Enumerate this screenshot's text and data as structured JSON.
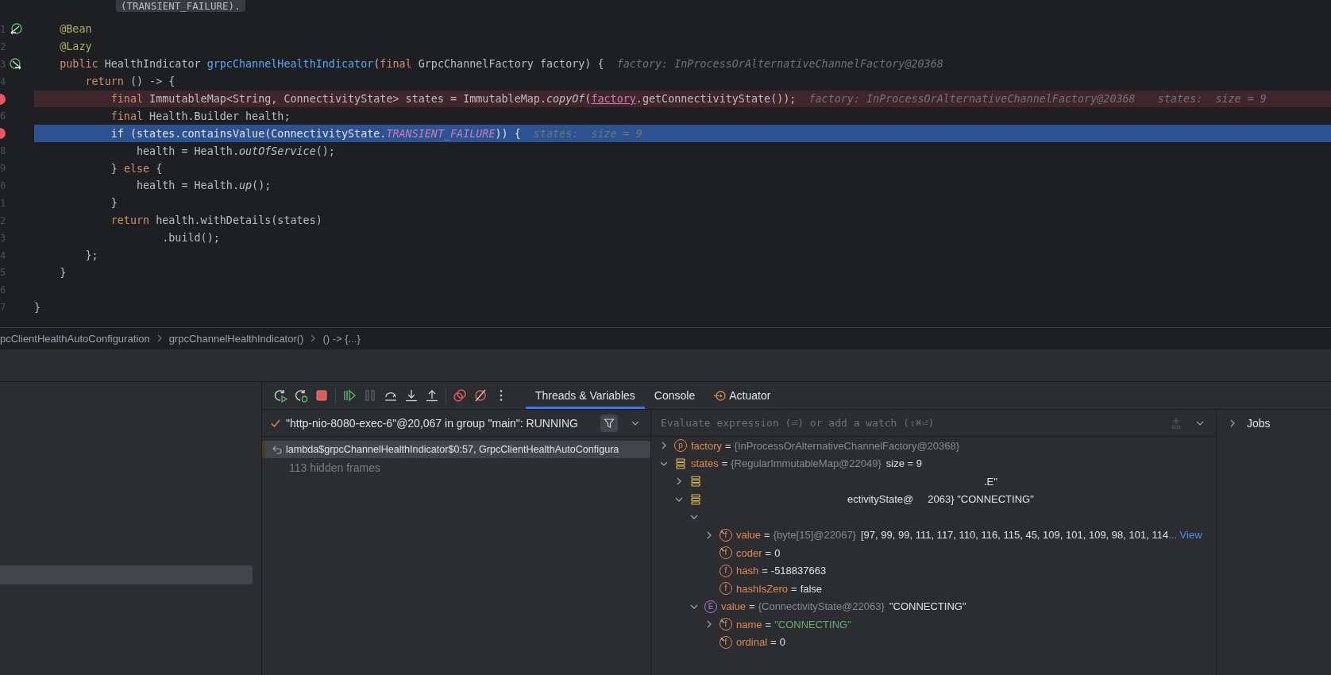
{
  "editor": {
    "tooltip_fragment": "(TRANSIENT_FAILURE).",
    "lines": [
      {
        "number": "1",
        "gutter": {
          "kind": "bean-out"
        },
        "code": [
          {
            "kind": "ann",
            "t": "    @Bean"
          }
        ]
      },
      {
        "number": "2",
        "code": [
          {
            "kind": "ann",
            "t": "    @Lazy"
          }
        ]
      },
      {
        "number": "3",
        "gutter": {
          "kind": "bean-in"
        },
        "code": [
          {
            "kind": "kw",
            "t": "    public"
          },
          {
            "kind": "p",
            "t": " HealthIndicator "
          },
          {
            "kind": "fn",
            "t": "grpcChannelHealthIndicator"
          },
          {
            "kind": "p",
            "t": "("
          },
          {
            "kind": "kw",
            "t": "final"
          },
          {
            "kind": "p",
            "t": " GrpcChannelFactory factory) {"
          }
        ],
        "hints": [
          "factory: InProcessOrAlternativeChannelFactory@20368"
        ]
      },
      {
        "number": "4",
        "code": [
          {
            "kind": "kw",
            "t": "        return"
          },
          {
            "kind": "p",
            "t": " () -> {"
          }
        ]
      },
      {
        "gutter": {
          "kind": "breakpoint"
        },
        "highlight": {
          "kind": "breakpoint"
        },
        "code": [
          {
            "kind": "kw",
            "t": "            final"
          },
          {
            "kind": "p",
            "t": " ImmutableMap<String, ConnectivityState> states = ImmutableMap."
          },
          {
            "kind": "it",
            "t": "copyOf"
          },
          {
            "kind": "p",
            "t": "("
          },
          {
            "kind": "link",
            "t": "factory"
          },
          {
            "kind": "p",
            "t": ".getConnectivityState());"
          }
        ],
        "hints": [
          "factory: InProcessOrAlternativeChannelFactory@20368",
          "states:  size = 9"
        ]
      },
      {
        "number": "6",
        "code": [
          {
            "kind": "kw",
            "t": "            final"
          },
          {
            "kind": "p",
            "t": " Health.Builder health;"
          }
        ]
      },
      {
        "gutter": {
          "kind": "breakpoint"
        },
        "highlight": {
          "kind": "current"
        },
        "code": [
          {
            "kind": "kw",
            "t": "            if"
          },
          {
            "kind": "p",
            "t": " (states.containsValue(ConnectivityState."
          },
          {
            "kind": "const",
            "t": "TRANSIENT_FAILURE"
          },
          {
            "kind": "p",
            "t": ")) {"
          }
        ],
        "hints": [
          "states:  size = 9"
        ]
      },
      {
        "number": "8",
        "code": [
          {
            "kind": "p",
            "t": "                health = Health."
          },
          {
            "kind": "it",
            "t": "outOfService"
          },
          {
            "kind": "p",
            "t": "();"
          }
        ]
      },
      {
        "number": "9",
        "code": [
          {
            "kind": "p",
            "t": "            } "
          },
          {
            "kind": "kw",
            "t": "else"
          },
          {
            "kind": "p",
            "t": " {"
          }
        ]
      },
      {
        "number": "0",
        "code": [
          {
            "kind": "p",
            "t": "                health = Health."
          },
          {
            "kind": "it",
            "t": "up"
          },
          {
            "kind": "p",
            "t": "();"
          }
        ]
      },
      {
        "number": "1",
        "code": [
          {
            "kind": "p",
            "t": "            }"
          }
        ]
      },
      {
        "number": "2",
        "code": [
          {
            "kind": "kw",
            "t": "            return"
          },
          {
            "kind": "p",
            "t": " health.withDetails(states)"
          }
        ]
      },
      {
        "number": "3",
        "code": [
          {
            "kind": "p",
            "t": "                    .build();"
          }
        ]
      },
      {
        "number": "4",
        "code": [
          {
            "kind": "p",
            "t": "        };"
          }
        ]
      },
      {
        "number": "5",
        "code": [
          {
            "kind": "p",
            "t": "    }"
          }
        ]
      },
      {
        "number": "6"
      },
      {
        "number": "7",
        "code": [
          {
            "kind": "p",
            "t": "}"
          }
        ]
      }
    ]
  },
  "breadcrumbs": [
    "pcClientHealthAutoConfiguration",
    "grpcChannelHealthIndicator()",
    "() -> {...}"
  ],
  "debugger": {
    "toolbar_groups": [
      [
        {
          "kind": "rerun",
          "disabled": false
        },
        {
          "kind": "rerun-debug",
          "disabled": false
        },
        {
          "kind": "stop",
          "disabled": false
        }
      ],
      [
        {
          "kind": "resume",
          "disabled": false
        },
        {
          "kind": "pause",
          "disabled": true
        },
        {
          "kind": "step-over",
          "disabled": false
        },
        {
          "kind": "step-into",
          "disabled": false
        },
        {
          "kind": "step-out",
          "disabled": false
        }
      ],
      [
        {
          "kind": "breakpoints",
          "disabled": false
        },
        {
          "kind": "mute",
          "disabled": false
        },
        {
          "kind": "more",
          "disabled": false
        }
      ]
    ],
    "tabs": [
      {
        "label": "Threads & Variables",
        "selected": true,
        "kind": "plain"
      },
      {
        "label": "Console",
        "selected": false,
        "kind": "plain"
      },
      {
        "label": "Actuator",
        "selected": false,
        "kind": "actuator"
      }
    ],
    "thread": {
      "label": "\"http-nio-8080-exec-6\"@20,067 in group \"main\": RUNNING"
    },
    "frames": [
      {
        "label": "lambda$grpcChannelHealthIndicator$0:57, GrpcClientHealthAutoConfigura",
        "selected": true
      }
    ],
    "hidden_frames": "113 hidden frames",
    "watch": {
      "placeholder": "Evaluate expression (⏎) or add a watch (⇧⌘⏎)"
    },
    "variables": [
      {
        "kind": "node",
        "expanded": false,
        "icon": {
          "kind": "param",
          "letter": "p"
        },
        "name": "factory",
        "op": "=",
        "type": "{InProcessOrAlternativeChannelFactory@20368}"
      },
      {
        "kind": "node",
        "expanded": true,
        "icon": {
          "kind": "map"
        },
        "name": "states",
        "op": "=",
        "type": "{RegularImmutableMap@22049}",
        "value": "size = 9",
        "children": [
          {
            "kind": "node",
            "expanded": false,
            "icon": {
              "kind": "map"
            },
            "parts": [
              ".E\""
            ]
          },
          {
            "kind": "node",
            "expanded": true,
            "icon": {
              "kind": "map"
            },
            "parts": [
              "ectivityState@",
              "2063} \"CONNECTING\""
            ],
            "children": [
              {
                "kind": "node",
                "expanded": true,
                "children": [
                  {
                    "kind": "node",
                    "expanded": false,
                    "icon": {
                      "kind": "field",
                      "letter": "f",
                      "final": true
                    },
                    "name": "value",
                    "op": "=",
                    "type": "{byte[15]@22067}",
                    "value": "[97, 99, 99, 111, 117, 110, 116, 115, 45, 109, 101, 109, 98, 101, 114",
                    "link": "... View"
                  },
                  {
                    "kind": "leaf",
                    "icon": {
                      "kind": "field",
                      "letter": "f",
                      "final": true
                    },
                    "name": "coder",
                    "op": "=",
                    "value": "0"
                  },
                  {
                    "kind": "leaf",
                    "icon": {
                      "kind": "field",
                      "letter": "f",
                      "final": false
                    },
                    "name": "hash",
                    "op": "=",
                    "value": "-518837663"
                  },
                  {
                    "kind": "leaf",
                    "icon": {
                      "kind": "field",
                      "letter": "f",
                      "final": false
                    },
                    "name": "hashIsZero",
                    "op": "=",
                    "value": "false"
                  }
                ]
              },
              {
                "kind": "node",
                "expanded": true,
                "icon": {
                  "kind": "enum",
                  "letter": "E"
                },
                "name": "value",
                "op": "=",
                "type": "{ConnectivityState@22063}",
                "value": "\"CONNECTING\"",
                "children": [
                  {
                    "kind": "node",
                    "expanded": false,
                    "icon": {
                      "kind": "field",
                      "letter": "f",
                      "final": true
                    },
                    "name": "name",
                    "op": "=",
                    "value": "\"CONNECTING\"",
                    "value_style": {
                      "kind": "string"
                    }
                  },
                  {
                    "kind": "leaf",
                    "icon": {
                      "kind": "field",
                      "letter": "f",
                      "final": true
                    },
                    "name": "ordinal",
                    "op": "=",
                    "value": "0"
                  }
                ]
              }
            ]
          }
        ]
      }
    ],
    "side_panel": {
      "label": "Jobs",
      "expanded": false
    }
  }
}
